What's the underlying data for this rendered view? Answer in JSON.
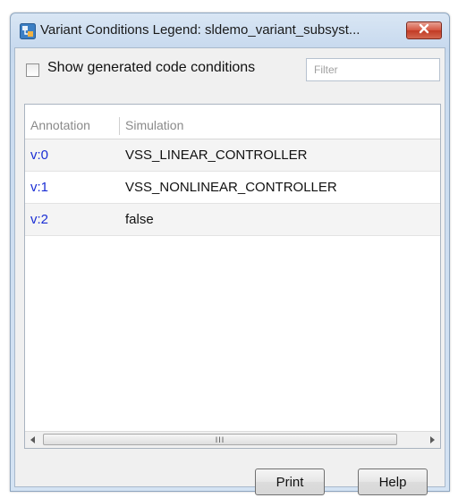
{
  "window": {
    "title": "Variant Conditions Legend: sldemo_variant_subsyst...",
    "app_icon": "simulink-icon",
    "close_icon": "close-icon"
  },
  "options": {
    "show_generated_label": "Show generated code conditions",
    "show_generated_checked": false,
    "filter_placeholder": "Filter",
    "filter_value": ""
  },
  "table": {
    "columns": [
      "Annotation",
      "Simulation"
    ],
    "rows": [
      {
        "annotation": "v:0",
        "simulation": "VSS_LINEAR_CONTROLLER"
      },
      {
        "annotation": "v:1",
        "simulation": "VSS_NONLINEAR_CONTROLLER"
      },
      {
        "annotation": "v:2",
        "simulation": "false"
      }
    ],
    "scroll_thumb_grip": "III"
  },
  "buttons": {
    "print_label": "Print",
    "help_label": "Help"
  },
  "colors": {
    "annotation_text": "#1a2ed4",
    "close_button": "#c23a24",
    "window_frame": "#c7d9ee"
  }
}
